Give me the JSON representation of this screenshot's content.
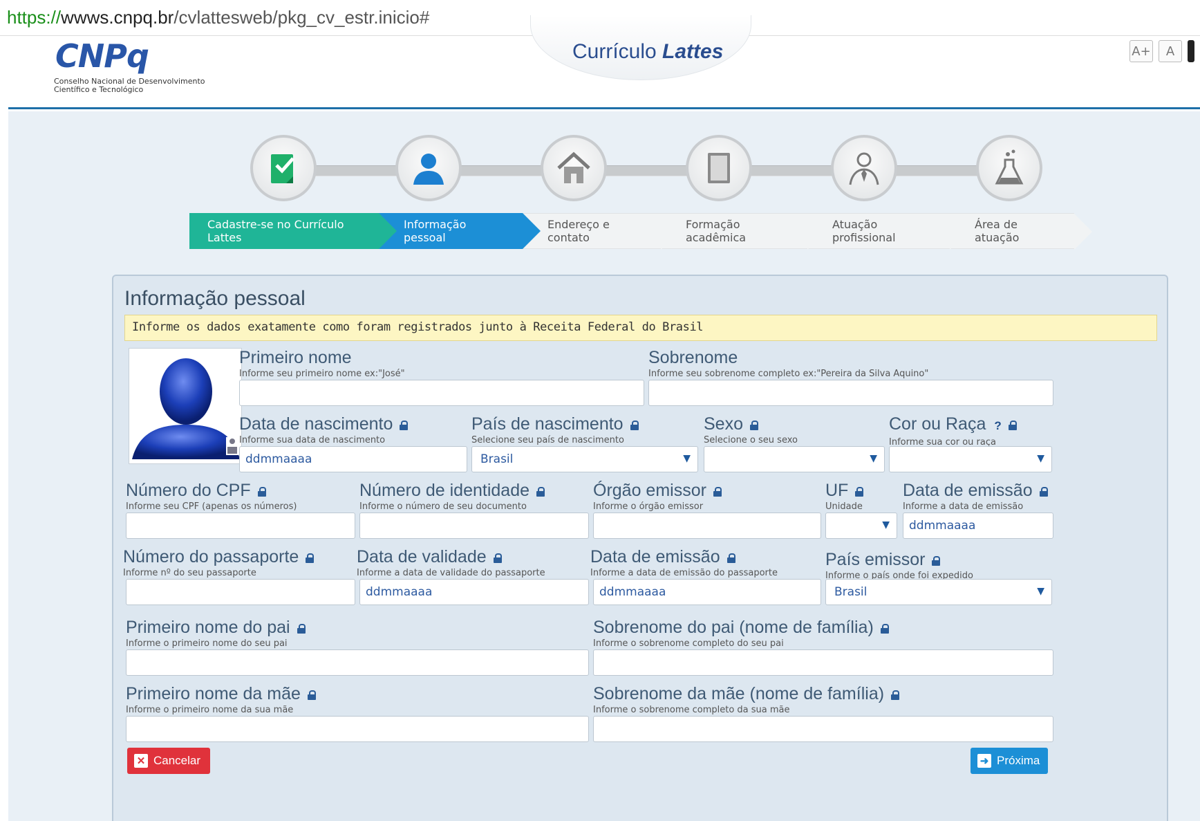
{
  "browser": {
    "url_prefix": "https://",
    "url_domain": "wwws.cnpq.br",
    "url_path": "/cvlattesweb/pkg_cv_estr.inicio#"
  },
  "header": {
    "logo_text": "CNPq",
    "logo_subtitle": "Conselho Nacional de Desenvolvimento Científico e Tecnológico",
    "product_prefix": "Currículo ",
    "product_name": "Lattes",
    "font_increase": "A+",
    "font_normal": "A"
  },
  "steps": [
    {
      "label": "Cadastre-se no Currículo Lattes",
      "icon": "checklist-icon",
      "state": "done"
    },
    {
      "label": "Informação pessoal",
      "icon": "person-icon",
      "state": "active"
    },
    {
      "label": "Endereço e contato",
      "icon": "house-icon",
      "state": "pending"
    },
    {
      "label": "Formação acadêmica",
      "icon": "book-icon",
      "state": "pending"
    },
    {
      "label": "Atuação profissional",
      "icon": "professional-icon",
      "state": "pending"
    },
    {
      "label": "Área de atuação",
      "icon": "flask-icon",
      "state": "pending"
    }
  ],
  "colors": {
    "done": "#1fb597",
    "active": "#1c8fd6",
    "cancel": "#e0323b",
    "notice_bg": "#fdf6c3"
  },
  "form": {
    "title": "Informação pessoal",
    "notice": "Informe os dados exatamente como foram registrados junto à Receita Federal do Brasil",
    "primeiro_nome": {
      "label": "Primeiro nome",
      "hint": "Informe seu primeiro nome ex:\"José\"",
      "value": ""
    },
    "sobrenome": {
      "label": "Sobrenome",
      "hint": "Informe seu sobrenome completo ex:\"Pereira da Silva Aquino\"",
      "value": ""
    },
    "data_nascimento": {
      "label": "Data de nascimento",
      "hint": "Informe sua data de nascimento",
      "placeholder": "ddmmaaaa"
    },
    "pais_nascimento": {
      "label": "País de nascimento",
      "hint": "Selecione seu país de nascimento",
      "value": "Brasil"
    },
    "sexo": {
      "label": "Sexo",
      "hint": "Selecione o seu sexo",
      "value": ""
    },
    "cor_raca": {
      "label": "Cor ou Raça",
      "help": "?",
      "hint": "Informe sua cor ou raça",
      "value": ""
    },
    "cpf": {
      "label": "Número do CPF",
      "hint": "Informe seu CPF (apenas os números)",
      "value": ""
    },
    "identidade": {
      "label": "Número de identidade",
      "hint": "Informe o número de seu documento",
      "value": ""
    },
    "orgao_emissor": {
      "label": "Órgão emissor",
      "hint": "Informe o órgão emissor",
      "value": ""
    },
    "uf": {
      "label": "UF",
      "hint": "Unidade",
      "value": ""
    },
    "data_emissao_id": {
      "label": "Data de emissão",
      "hint": "Informe a data de emissão",
      "placeholder": "ddmmaaaa"
    },
    "passaporte": {
      "label": "Número do passaporte",
      "hint": "Informe nº do seu passaporte",
      "value": ""
    },
    "data_validade": {
      "label": "Data de validade",
      "hint": "Informe a data de validade do passaporte",
      "placeholder": "ddmmaaaa"
    },
    "data_emissao_pass": {
      "label": "Data de emissão",
      "hint": "Informe a data de emissão do passaporte",
      "placeholder": "ddmmaaaa"
    },
    "pais_emissor": {
      "label": "País emissor",
      "hint": "Informe o país onde foi expedido",
      "value": "Brasil"
    },
    "pai_nome": {
      "label": "Primeiro nome do pai",
      "hint": "Informe o primeiro nome do seu pai",
      "value": ""
    },
    "pai_sobrenome": {
      "label": "Sobrenome do pai (nome de família)",
      "hint": "Informe o sobrenome completo do seu pai",
      "value": ""
    },
    "mae_nome": {
      "label": "Primeiro nome da mãe",
      "hint": "Informe o primeiro nome da sua mãe",
      "value": ""
    },
    "mae_sobrenome": {
      "label": "Sobrenome da mãe (nome de família)",
      "hint": "Informe o sobrenome completo da sua mãe",
      "value": ""
    },
    "cancel_label": "Cancelar",
    "next_label": "Próxima",
    "cancel_icon": "close-icon",
    "next_icon": "arrow-right-icon"
  }
}
